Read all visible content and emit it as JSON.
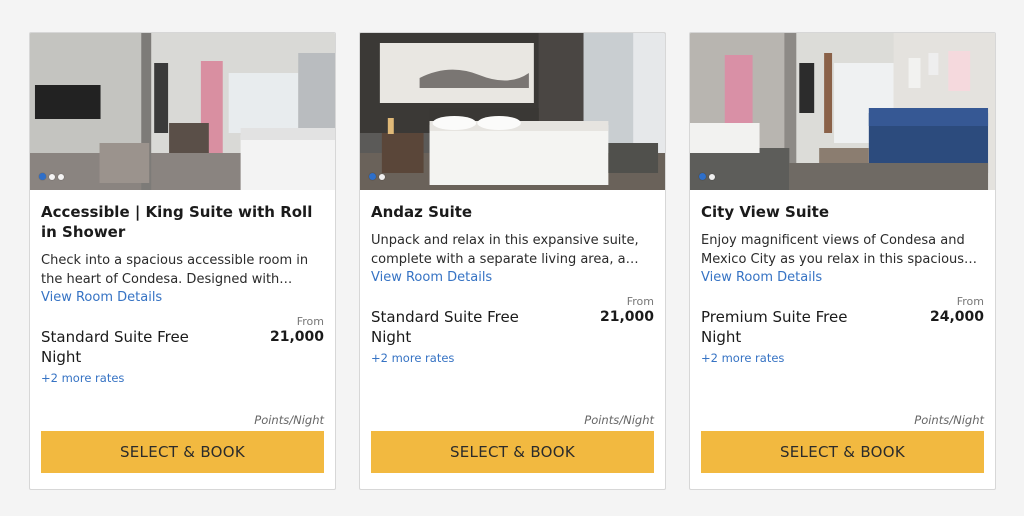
{
  "rooms": [
    {
      "title": "Accessible | King Suite with Roll in Shower",
      "description": "Check into a spacious accessible room in the heart of Condesa. Designed with comfort a...",
      "details_link": "View Room Details",
      "rate_name": "Standard Suite Free Night",
      "from_label": "From",
      "price": "21,000",
      "more_rates": "+2 more rates",
      "points_label": "Points/Night",
      "book_label": "SELECT & BOOK",
      "image_dots": 3,
      "image_active_dot": 1
    },
    {
      "title": "Andaz Suite",
      "description": "Unpack and relax in this expansive suite, complete with a separate living area, a sofa...",
      "details_link": "View Room Details",
      "rate_name": "Standard Suite Free Night",
      "from_label": "From",
      "price": "21,000",
      "more_rates": "+2 more rates",
      "points_label": "Points/Night",
      "book_label": "SELECT & BOOK",
      "image_dots": 2,
      "image_active_dot": 1
    },
    {
      "title": "City View Suite",
      "description": "Enjoy magnificent views of Condesa and Mexico City as you relax in this spacious sui...",
      "details_link": "View Room Details",
      "rate_name": "Premium Suite Free Night",
      "from_label": "From",
      "price": "24,000",
      "more_rates": "+2 more rates",
      "points_label": "Points/Night",
      "book_label": "SELECT & BOOK",
      "image_dots": 2,
      "image_active_dot": 1
    }
  ],
  "colors": {
    "button": "#f2b940",
    "link": "#3673c4",
    "active_dot": "#2f6fc9"
  }
}
